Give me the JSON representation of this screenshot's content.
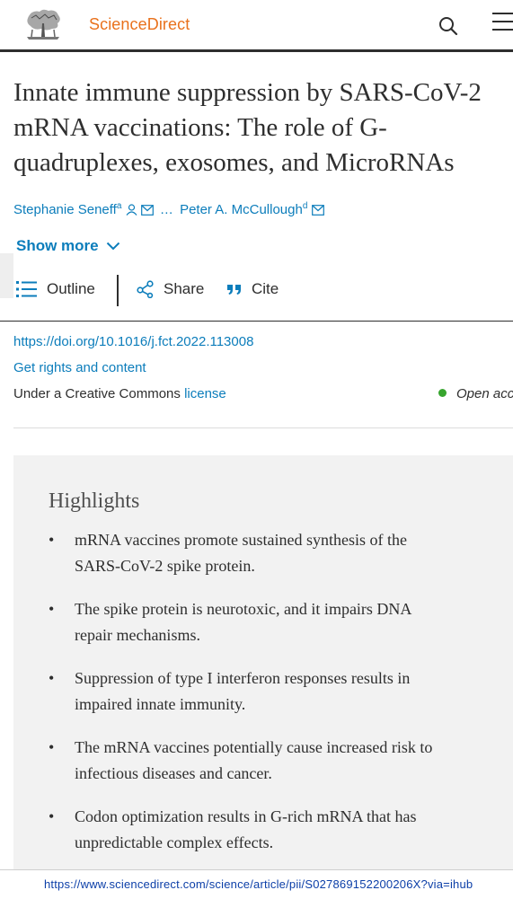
{
  "header": {
    "brand": "ScienceDirect",
    "brand_color": "#e9711c",
    "logo_icon": "elsevier-tree-logo",
    "search_icon": "search-icon",
    "menu_icon": "hamburger-menu-icon"
  },
  "article": {
    "title_lines": [
      "Innate immune suppression by SARS-CoV-2",
      "mRNA vaccinations: The role of G-",
      "quadruplexes, exosomes, and MicroRNAs"
    ],
    "author_first": "Stephanie Seneff",
    "author_first_sup": "a",
    "ellipsis": "…",
    "author_last": "Peter A. McCullough",
    "author_last_sup": "d",
    "show_more": "Show more",
    "doi": "https://doi.org/10.1016/j.fct.2022.113008",
    "rights": "Get rights and content",
    "license_prefix": "Under a Creative Commons",
    "license_link": "license",
    "open_access": "Open acce"
  },
  "actions": {
    "outline": "Outline",
    "share": "Share",
    "cite": "Cite"
  },
  "highlights": {
    "title": "Highlights",
    "bullet": "•",
    "items": [
      [
        "mRNA vaccines promote sustained synthesis of the",
        "SARS-CoV-2 spike protein."
      ],
      [
        "The spike protein is neurotoxic, and it impairs DNA",
        "repair mechanisms."
      ],
      [
        "Suppression of type I interferon responses results in",
        "impaired innate immunity."
      ],
      [
        "The mRNA vaccines potentially cause increased risk to",
        "infectious diseases and cancer."
      ],
      [
        "Codon optimization results in G-rich mRNA that has",
        "unpredictable complex effects."
      ]
    ]
  },
  "statusbar": {
    "url": "https://www.sciencedirect.com/science/article/pii/S027869152200206X?via=ihub"
  },
  "colors": {
    "link": "#0c7dbb",
    "text": "#2e2e2e",
    "highlight_bg": "#f2f2f2",
    "open_access_dot": "#37a52e"
  }
}
